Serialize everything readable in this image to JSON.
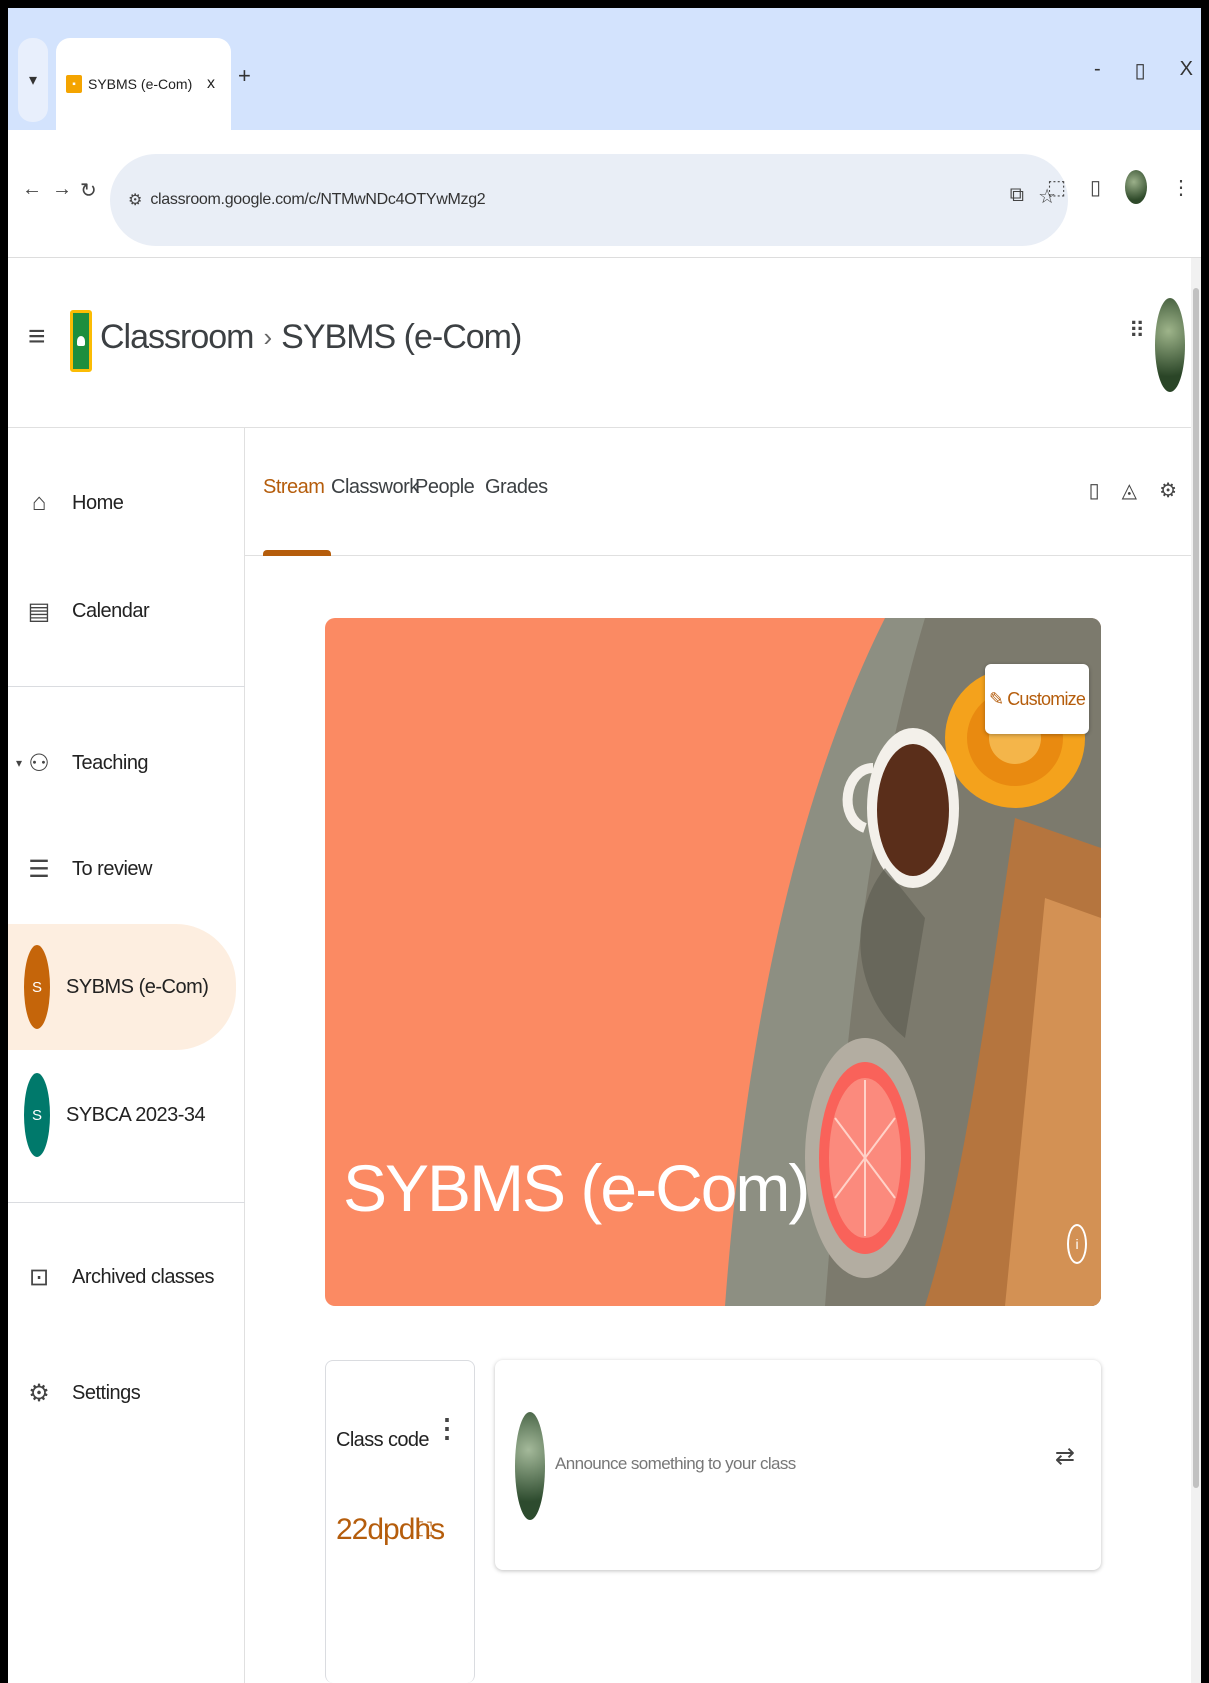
{
  "browser": {
    "tab_title": "SYBMS (e-Com)",
    "tab_close": "x",
    "new_tab": "+",
    "url": "classroom.google.com/c/NTMwNDc4OTYwMzg2",
    "window_controls": [
      "-",
      "▯",
      "X"
    ]
  },
  "header": {
    "app_name": "Classroom",
    "separator": "›",
    "current_class": "SYBMS (e-Com)"
  },
  "sidebar": {
    "items": [
      {
        "label": "Home",
        "icon": "home-icon"
      },
      {
        "label": "Calendar",
        "icon": "calendar-icon"
      },
      {
        "label": "Teaching",
        "icon": "people-icon"
      },
      {
        "label": "To review",
        "icon": "review-icon"
      },
      {
        "label": "SYBMS (e-Com)",
        "badge": "S",
        "badge_color": "#c5650a"
      },
      {
        "label": "SYBCA 2023-34",
        "badge": "S",
        "badge_color": "#00796b"
      },
      {
        "label": "Archived classes",
        "icon": "archive-icon"
      },
      {
        "label": "Settings",
        "icon": "gear-icon"
      }
    ]
  },
  "main": {
    "tabs": [
      {
        "label": "Stream"
      },
      {
        "label": "Classwork"
      },
      {
        "label": "People"
      },
      {
        "label": "Grades"
      }
    ],
    "banner": {
      "title": "SYBMS (e-Com)",
      "customize_label": "Customize",
      "info": "i"
    },
    "class_code": {
      "label": "Class code",
      "value": "22dpdhs"
    },
    "announce": {
      "placeholder": "Announce something to your class"
    }
  },
  "colors": {
    "accent": "#b55d0c",
    "banner": "#fb8a63",
    "active_nav": "#fdeee0"
  }
}
